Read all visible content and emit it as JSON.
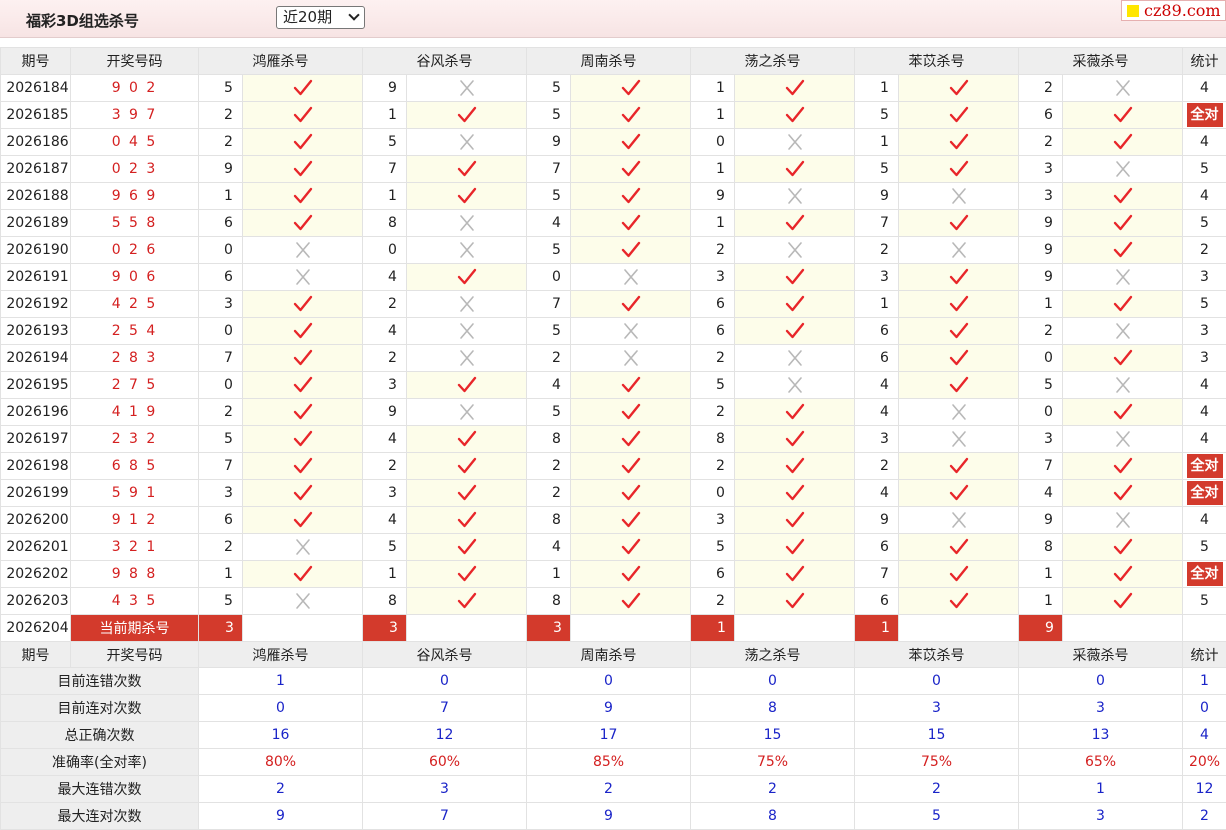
{
  "header": {
    "title": "福彩3D组选杀号",
    "period_selected": "近20期",
    "site_badge": "cz89.com"
  },
  "columns": {
    "issue": "期号",
    "draw": "开奖号码",
    "experts": [
      "鸿雁杀号",
      "谷风杀号",
      "周南杀号",
      "荡之杀号",
      "苯苡杀号",
      "采薇杀号"
    ],
    "stat": "统计"
  },
  "rows": [
    {
      "issue": "2026184",
      "draw": "9 0 2",
      "kills": [
        5,
        9,
        5,
        1,
        1,
        2
      ],
      "ok": [
        1,
        0,
        1,
        1,
        1,
        0
      ],
      "stat": "4"
    },
    {
      "issue": "2026185",
      "draw": "3 9 7",
      "kills": [
        2,
        1,
        5,
        1,
        5,
        6
      ],
      "ok": [
        1,
        1,
        1,
        1,
        1,
        1
      ],
      "stat": "全对"
    },
    {
      "issue": "2026186",
      "draw": "0 4 5",
      "kills": [
        2,
        5,
        9,
        0,
        1,
        2
      ],
      "ok": [
        1,
        0,
        1,
        0,
        1,
        1
      ],
      "stat": "4"
    },
    {
      "issue": "2026187",
      "draw": "0 2 3",
      "kills": [
        9,
        7,
        7,
        1,
        5,
        3
      ],
      "ok": [
        1,
        1,
        1,
        1,
        1,
        0
      ],
      "stat": "5"
    },
    {
      "issue": "2026188",
      "draw": "9 6 9",
      "kills": [
        1,
        1,
        5,
        9,
        9,
        3
      ],
      "ok": [
        1,
        1,
        1,
        0,
        0,
        1
      ],
      "stat": "4"
    },
    {
      "issue": "2026189",
      "draw": "5 5 8",
      "kills": [
        6,
        8,
        4,
        1,
        7,
        9
      ],
      "ok": [
        1,
        0,
        1,
        1,
        1,
        1
      ],
      "stat": "5"
    },
    {
      "issue": "2026190",
      "draw": "0 2 6",
      "kills": [
        0,
        0,
        5,
        2,
        2,
        9
      ],
      "ok": [
        0,
        0,
        1,
        0,
        0,
        1
      ],
      "stat": "2"
    },
    {
      "issue": "2026191",
      "draw": "9 0 6",
      "kills": [
        6,
        4,
        0,
        3,
        3,
        9
      ],
      "ok": [
        0,
        1,
        0,
        1,
        1,
        0
      ],
      "stat": "3"
    },
    {
      "issue": "2026192",
      "draw": "4 2 5",
      "kills": [
        3,
        2,
        7,
        6,
        1,
        1
      ],
      "ok": [
        1,
        0,
        1,
        1,
        1,
        1
      ],
      "stat": "5"
    },
    {
      "issue": "2026193",
      "draw": "2 5 4",
      "kills": [
        0,
        4,
        5,
        6,
        6,
        2
      ],
      "ok": [
        1,
        0,
        0,
        1,
        1,
        0
      ],
      "stat": "3"
    },
    {
      "issue": "2026194",
      "draw": "2 8 3",
      "kills": [
        7,
        2,
        2,
        2,
        6,
        0
      ],
      "ok": [
        1,
        0,
        0,
        0,
        1,
        1
      ],
      "stat": "3"
    },
    {
      "issue": "2026195",
      "draw": "2 7 5",
      "kills": [
        0,
        3,
        4,
        5,
        4,
        5
      ],
      "ok": [
        1,
        1,
        1,
        0,
        1,
        0
      ],
      "stat": "4"
    },
    {
      "issue": "2026196",
      "draw": "4 1 9",
      "kills": [
        2,
        9,
        5,
        2,
        4,
        0
      ],
      "ok": [
        1,
        0,
        1,
        1,
        0,
        1
      ],
      "stat": "4"
    },
    {
      "issue": "2026197",
      "draw": "2 3 2",
      "kills": [
        5,
        4,
        8,
        8,
        3,
        3
      ],
      "ok": [
        1,
        1,
        1,
        1,
        0,
        0
      ],
      "stat": "4"
    },
    {
      "issue": "2026198",
      "draw": "6 8 5",
      "kills": [
        7,
        2,
        2,
        2,
        2,
        7
      ],
      "ok": [
        1,
        1,
        1,
        1,
        1,
        1
      ],
      "stat": "全对"
    },
    {
      "issue": "2026199",
      "draw": "5 9 1",
      "kills": [
        3,
        3,
        2,
        0,
        4,
        4
      ],
      "ok": [
        1,
        1,
        1,
        1,
        1,
        1
      ],
      "stat": "全对"
    },
    {
      "issue": "2026200",
      "draw": "9 1 2",
      "kills": [
        6,
        4,
        8,
        3,
        9,
        9
      ],
      "ok": [
        1,
        1,
        1,
        1,
        0,
        0
      ],
      "stat": "4"
    },
    {
      "issue": "2026201",
      "draw": "3 2 1",
      "kills": [
        2,
        5,
        4,
        5,
        6,
        8
      ],
      "ok": [
        0,
        1,
        1,
        1,
        1,
        1
      ],
      "stat": "5"
    },
    {
      "issue": "2026202",
      "draw": "9 8 8",
      "kills": [
        1,
        1,
        1,
        6,
        7,
        1
      ],
      "ok": [
        1,
        1,
        1,
        1,
        1,
        1
      ],
      "stat": "全对"
    },
    {
      "issue": "2026203",
      "draw": "4 3 5",
      "kills": [
        5,
        8,
        8,
        2,
        6,
        1
      ],
      "ok": [
        0,
        1,
        1,
        1,
        1,
        1
      ],
      "stat": "5"
    }
  ],
  "current": {
    "issue": "2026204",
    "label": "当前期杀号",
    "kills": [
      3,
      3,
      3,
      1,
      1,
      9
    ]
  },
  "summary": [
    {
      "label": "目前连错次数",
      "values": [
        "1",
        "0",
        "0",
        "0",
        "0",
        "0"
      ],
      "stat": "1",
      "red": false
    },
    {
      "label": "目前连对次数",
      "values": [
        "0",
        "7",
        "9",
        "8",
        "3",
        "3"
      ],
      "stat": "0",
      "red": false
    },
    {
      "label": "总正确次数",
      "values": [
        "16",
        "12",
        "17",
        "15",
        "15",
        "13"
      ],
      "stat": "4",
      "red": false
    },
    {
      "label": "准确率(全对率)",
      "values": [
        "80%",
        "60%",
        "85%",
        "75%",
        "75%",
        "65%"
      ],
      "stat": "20%",
      "red": true
    },
    {
      "label": "最大连错次数",
      "values": [
        "2",
        "3",
        "2",
        "2",
        "2",
        "1"
      ],
      "stat": "12",
      "red": false
    },
    {
      "label": "最大连对次数",
      "values": [
        "9",
        "7",
        "9",
        "8",
        "5",
        "3"
      ],
      "stat": "2",
      "red": false
    }
  ],
  "colors": {
    "check": "#e8262a",
    "cross": "#b8b8b8",
    "accent": "#d33a2c",
    "summary_blue": "#1a24c8"
  },
  "icons": {
    "ok": "check-icon",
    "wrong": "cross-icon"
  }
}
